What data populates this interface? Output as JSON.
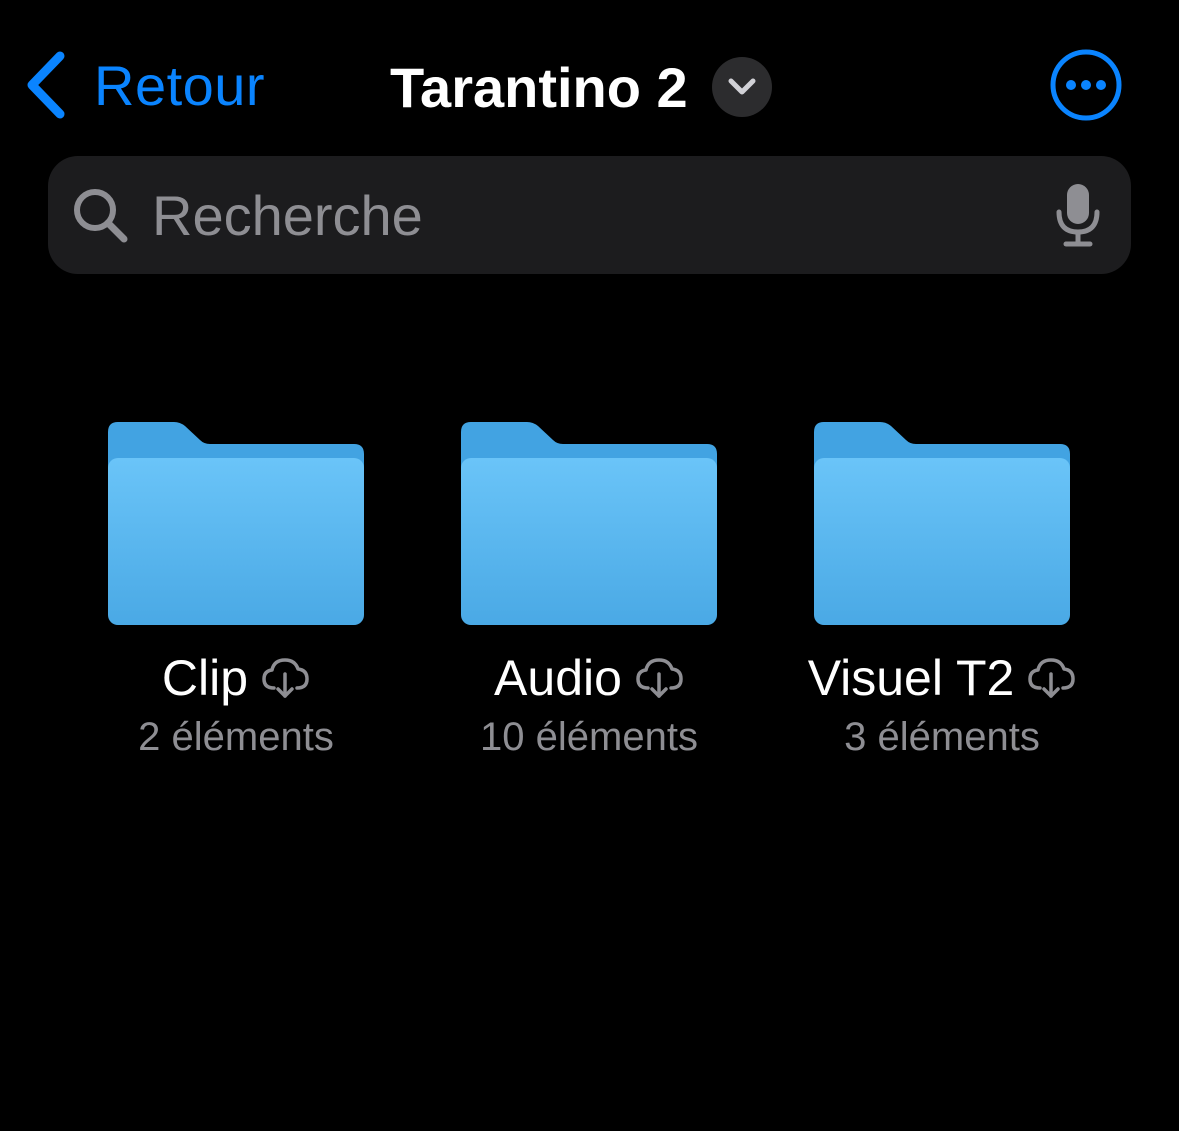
{
  "nav": {
    "back_label": "Retour",
    "title": "Tarantino 2",
    "back_icon": "chevron-left-icon",
    "title_menu_icon": "chevron-down-icon",
    "more_icon": "ellipsis-circle-icon"
  },
  "search": {
    "placeholder": "Recherche",
    "value": "",
    "search_icon": "magnifier-icon",
    "mic_icon": "microphone-icon"
  },
  "folders": [
    {
      "name": "Clip",
      "count": "2 éléments",
      "status_icon": "cloud-download-icon"
    },
    {
      "name": "Audio",
      "count": "10 éléments",
      "status_icon": "cloud-download-icon"
    },
    {
      "name": "Visuel T2",
      "count": "3 éléments",
      "status_icon": "cloud-download-icon"
    }
  ],
  "colors": {
    "accent": "#0a84ff",
    "background": "#000000",
    "search_bg": "#1c1c1e",
    "secondary_text": "#8e8e93",
    "folder_back": "#42a3e2",
    "folder_front_top": "#6ac4f8",
    "folder_front_bottom": "#4aa9e5"
  }
}
